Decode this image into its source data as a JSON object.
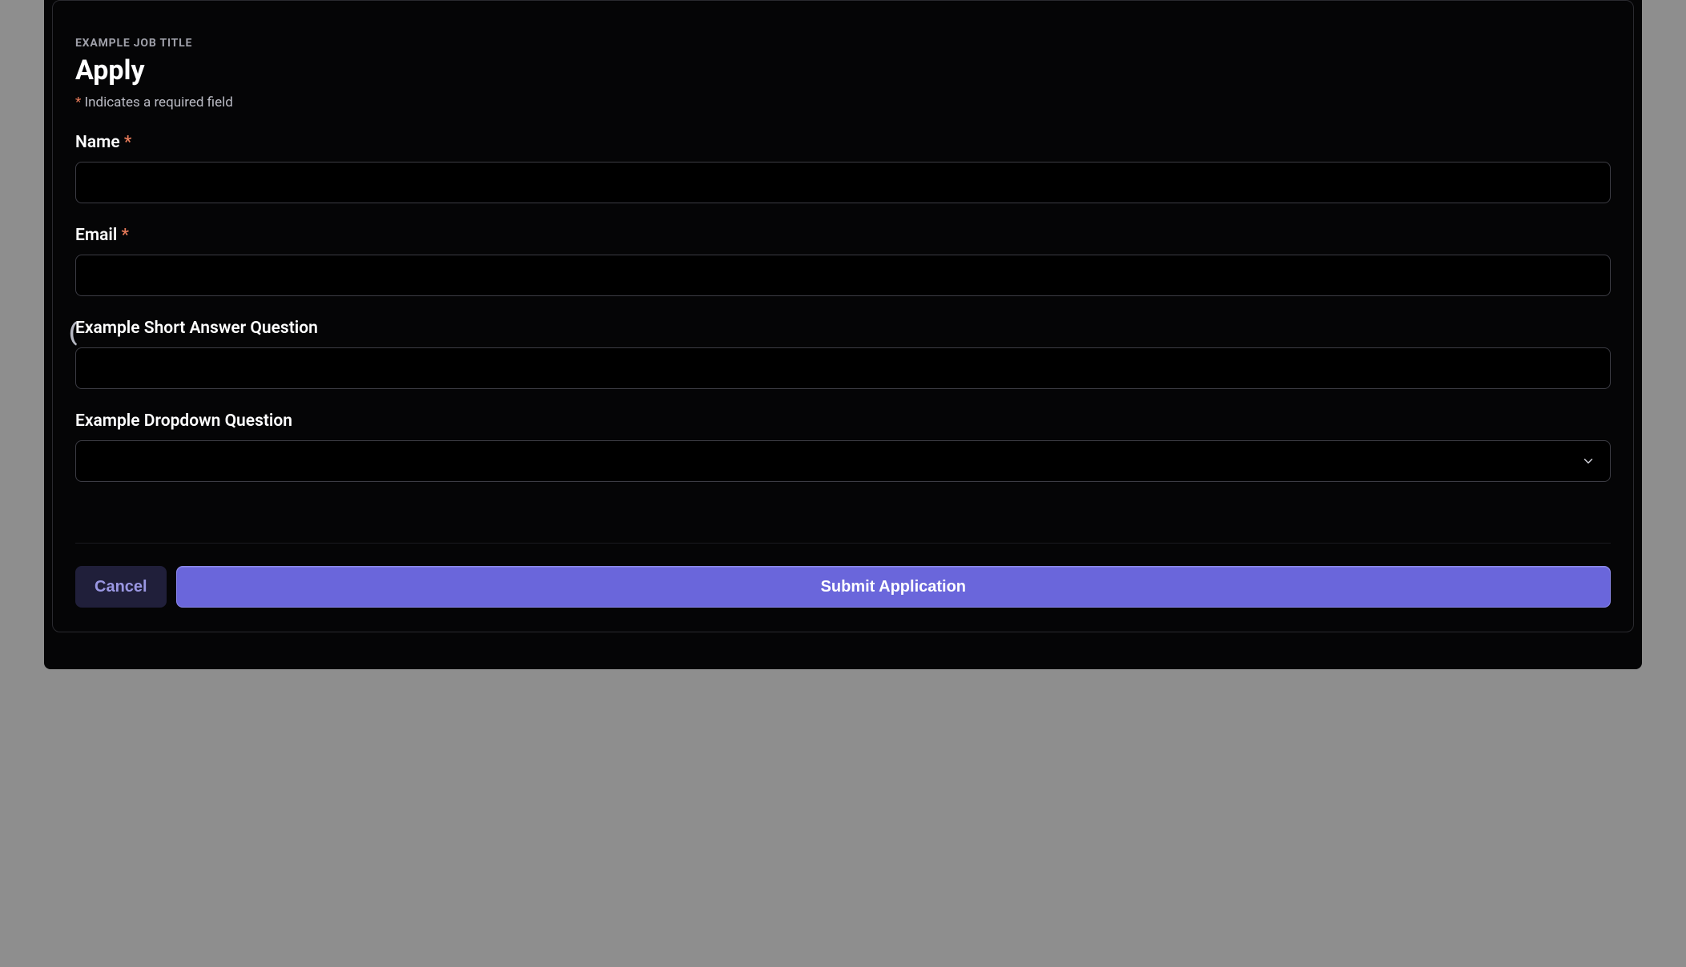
{
  "header": {
    "eyebrow": "EXAMPLE JOB TITLE",
    "title": "Apply",
    "required_asterisk": "*",
    "required_note": " Indicates a required field"
  },
  "fields": {
    "name": {
      "label": "Name ",
      "asterisk": "*",
      "value": ""
    },
    "email": {
      "label": "Email ",
      "asterisk": "*",
      "value": ""
    },
    "short_answer": {
      "label": "Example Short Answer Question",
      "value": ""
    },
    "dropdown": {
      "label": "Example Dropdown Question",
      "selected": ""
    }
  },
  "buttons": {
    "cancel": "Cancel",
    "submit": "Submit Application"
  },
  "decor": {
    "side_paren": "("
  }
}
